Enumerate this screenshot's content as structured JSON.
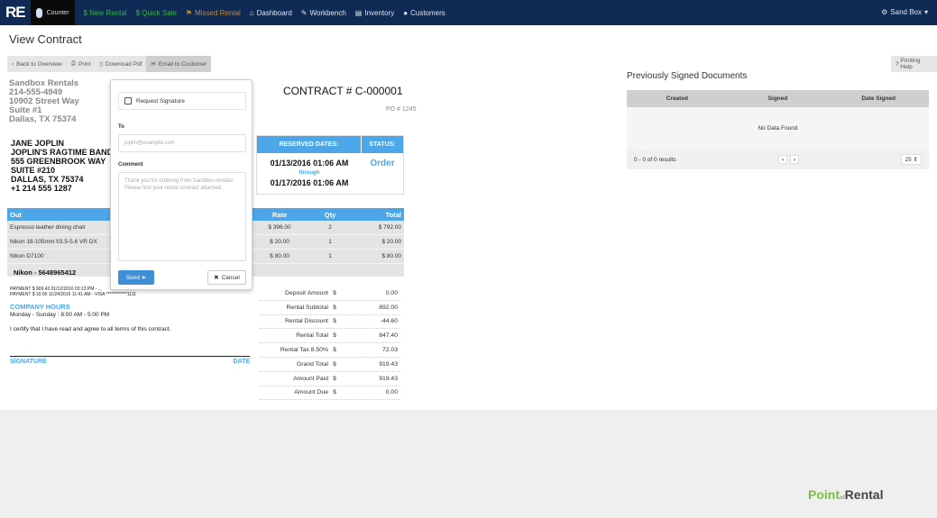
{
  "nav": {
    "logo": "RE",
    "counter": "Counter",
    "items": [
      "$ New Rental",
      "$ Quick Sale",
      "Missed Rental",
      "Dashboard",
      "Workbench",
      "Inventory",
      "Customers"
    ],
    "account": "Sand Box"
  },
  "page_title": "View Contract",
  "toolbar": {
    "back": "Back to Overview",
    "print": "Print",
    "pdf": "Download Pdf",
    "email": "Email to Customer",
    "help": "Printing Help"
  },
  "company": [
    "Sandbox Rentals",
    "214-555-4949",
    "10902 Street Way",
    "Suite #1",
    "Dallas, TX 75374"
  ],
  "customer": [
    "JANE JOPLIN",
    "JOPLIN'S RAGTIME BAND",
    "555 GREENBROOK WAY",
    "SUITE #210",
    "DALLAS, TX 75374",
    "+1 214 555 1287"
  ],
  "contract": {
    "number": "CONTRACT # C-000001",
    "po": "PO # 1245",
    "reserved_label": "RESERVED DATES:",
    "status_label": "STATUS:",
    "start": "01/13/2016 01:06 AM",
    "through": "through",
    "end": "01/17/2016 01:06 AM",
    "status": "Order"
  },
  "items": {
    "headers": [
      "Out",
      "Rate",
      "Qty",
      "Total"
    ],
    "rows": [
      [
        "Espresso leather dining chair",
        "$ 396.00",
        "2",
        "$ 792.00"
      ],
      [
        "Nikon 18-105mm f/3.5-5.6 VR DX",
        "$ 20.00",
        "1",
        "$ 20.00"
      ],
      [
        "Nikon D7100",
        "$ 80.00",
        "1",
        "$ 80.00"
      ]
    ],
    "serial": "Nikon - 5648965412"
  },
  "payments": [
    "PAYMENT $ 909.43 01/12/2016 03:13 PM - ...",
    "PAYMENT $ 10.00 11/24/2016 11:41 AM - VISA ************1111"
  ],
  "hours": {
    "title": "COMPANY HOURS",
    "text": "Monday - Sunday : 8:00 AM - 5:00 PM"
  },
  "certify": "I certify that I have read and agree to all terms of this contract.",
  "signature": "SIGNATURE",
  "date": "DATE",
  "totals": [
    [
      "Deposit Amount",
      "$",
      "0.00"
    ],
    [
      "Rental Subtotal",
      "$",
      "892.00"
    ],
    [
      "Rental Discount",
      "$",
      "-44.60"
    ],
    [
      "Rental Total",
      "$",
      "847.40"
    ],
    [
      "Rental Tax 8.50%",
      "$",
      "72.03"
    ],
    [
      "Grand Total",
      "$",
      "919.43"
    ],
    [
      "Amount Paid",
      "$",
      "919.43"
    ],
    [
      "Amount Due",
      "$",
      "0.00"
    ]
  ],
  "email_popover": {
    "request_signature": "Request Signature",
    "to_label": "To",
    "to_placeholder": "joplin@example.com",
    "comment_label": "Comment",
    "comment": "Thank you for ordering from Sandbox rentals! Please find your rental contract attached.",
    "send": "Send",
    "cancel": "Cancel"
  },
  "signed_docs": {
    "title": "Previously Signed Documents",
    "headers": [
      "Created",
      "Signed",
      "Date Signed"
    ],
    "empty": "No Data Found",
    "results": "0 - 0 of 0 results",
    "page_size": "25"
  },
  "footer_brand": "Point of Rental"
}
